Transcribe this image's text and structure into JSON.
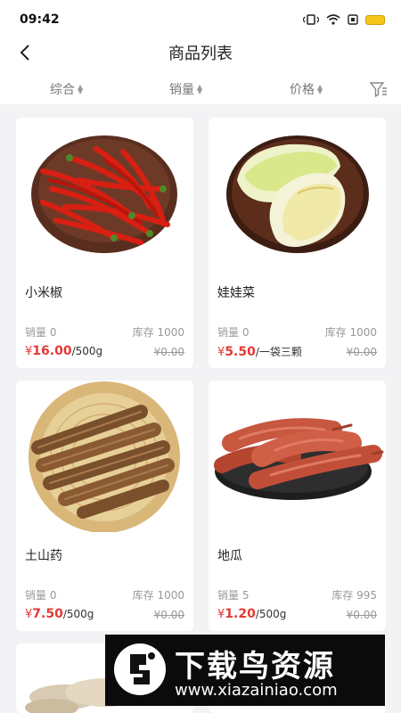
{
  "status_bar": {
    "time": "09:42"
  },
  "header": {
    "title": "商品列表"
  },
  "sort_bar": {
    "items": [
      {
        "label": "综合"
      },
      {
        "label": "销量"
      },
      {
        "label": "价格"
      }
    ]
  },
  "products": [
    {
      "name": "小米椒",
      "sales": "销量 0",
      "stock": "库存 1000",
      "currency": "¥",
      "price": "16.00",
      "unit": "/500g",
      "old_price": "¥0.00"
    },
    {
      "name": "娃娃菜",
      "sales": "销量 0",
      "stock": "库存 1000",
      "currency": "¥",
      "price": "5.50",
      "unit": "/一袋三颗",
      "old_price": "¥0.00"
    },
    {
      "name": "土山药",
      "sales": "销量 0",
      "stock": "库存 1000",
      "currency": "¥",
      "price": "7.50",
      "unit": "/500g",
      "old_price": "¥0.00"
    },
    {
      "name": "地瓜",
      "sales": "销量 5",
      "stock": "库存 995",
      "currency": "¥",
      "price": "1.20",
      "unit": "/500g",
      "old_price": "¥0.00"
    }
  ],
  "watermark": {
    "title": "下载鸟资源",
    "url": "www.xiazainiao.com"
  },
  "colors": {
    "accent_price": "#e53935",
    "background": "#f3f3f5"
  }
}
